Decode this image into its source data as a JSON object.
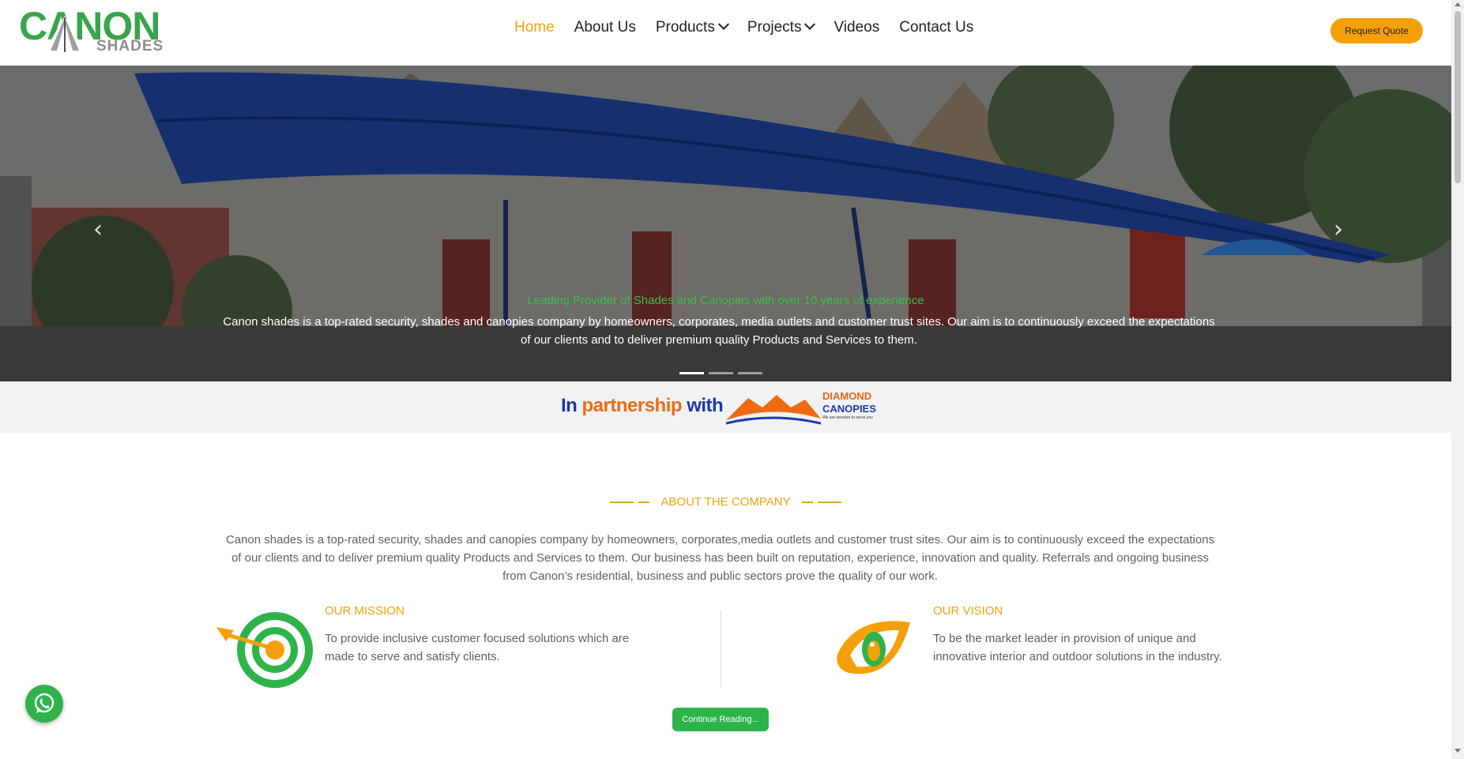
{
  "brand": {
    "logo_main": "CANON",
    "logo_sub": "SHADES"
  },
  "nav": {
    "items": [
      {
        "label": "Home",
        "active": true
      },
      {
        "label": "About Us"
      },
      {
        "label": "Products",
        "dropdown": true
      },
      {
        "label": "Projects",
        "dropdown": true
      },
      {
        "label": "Videos"
      },
      {
        "label": "Contact Us"
      }
    ],
    "quote_label": "Request Quote"
  },
  "hero": {
    "tagline": "Leading Provider of Shades and Canopies with over 10 years of experience",
    "text": "Canon shades is a top-rated security, shades and canopies company by homeowners, corporates, media outlets and customer trust sites. Our aim is to continuously exceed the expectations of our clients and to deliver premium quality Products and Services to them.",
    "prev_icon": "chevron-left-icon",
    "next_icon": "chevron-right-icon",
    "slides": 3,
    "active_slide": 1
  },
  "partner": {
    "in": "In",
    "partnership": "partnership",
    "with": "with",
    "logo_line1": "DIAMOND",
    "logo_line2": "CANOPIES",
    "logo_tagline": "We are devoted to serve you"
  },
  "about": {
    "heading": "ABOUT THE COMPANY",
    "text": "Canon shades is a top-rated security, shades and canopies company by homeowners, corporates,media outlets and customer trust sites. Our aim is to continuously exceed the expectations of our clients and to deliver premium quality Products and Services to them. Our business has been built on reputation, experience, innovation and quality. Referrals and ongoing business from Canon’s residential, business and public sectors prove the quality of our work.",
    "mission_title": "OUR MISSION",
    "mission_text": "To provide inclusive customer focused solutions which are made to serve and satisfy clients.",
    "vision_title": "OUR VISION",
    "vision_text": "To be the market leader in provision of unique and innovative interior and outdoor solutions in the industry.",
    "continue_label": "Continue Reading..."
  },
  "colors": {
    "accent": "#f0a30a",
    "green": "#2db34a",
    "blue": "#1d3aa8",
    "orange": "#f06a13"
  }
}
